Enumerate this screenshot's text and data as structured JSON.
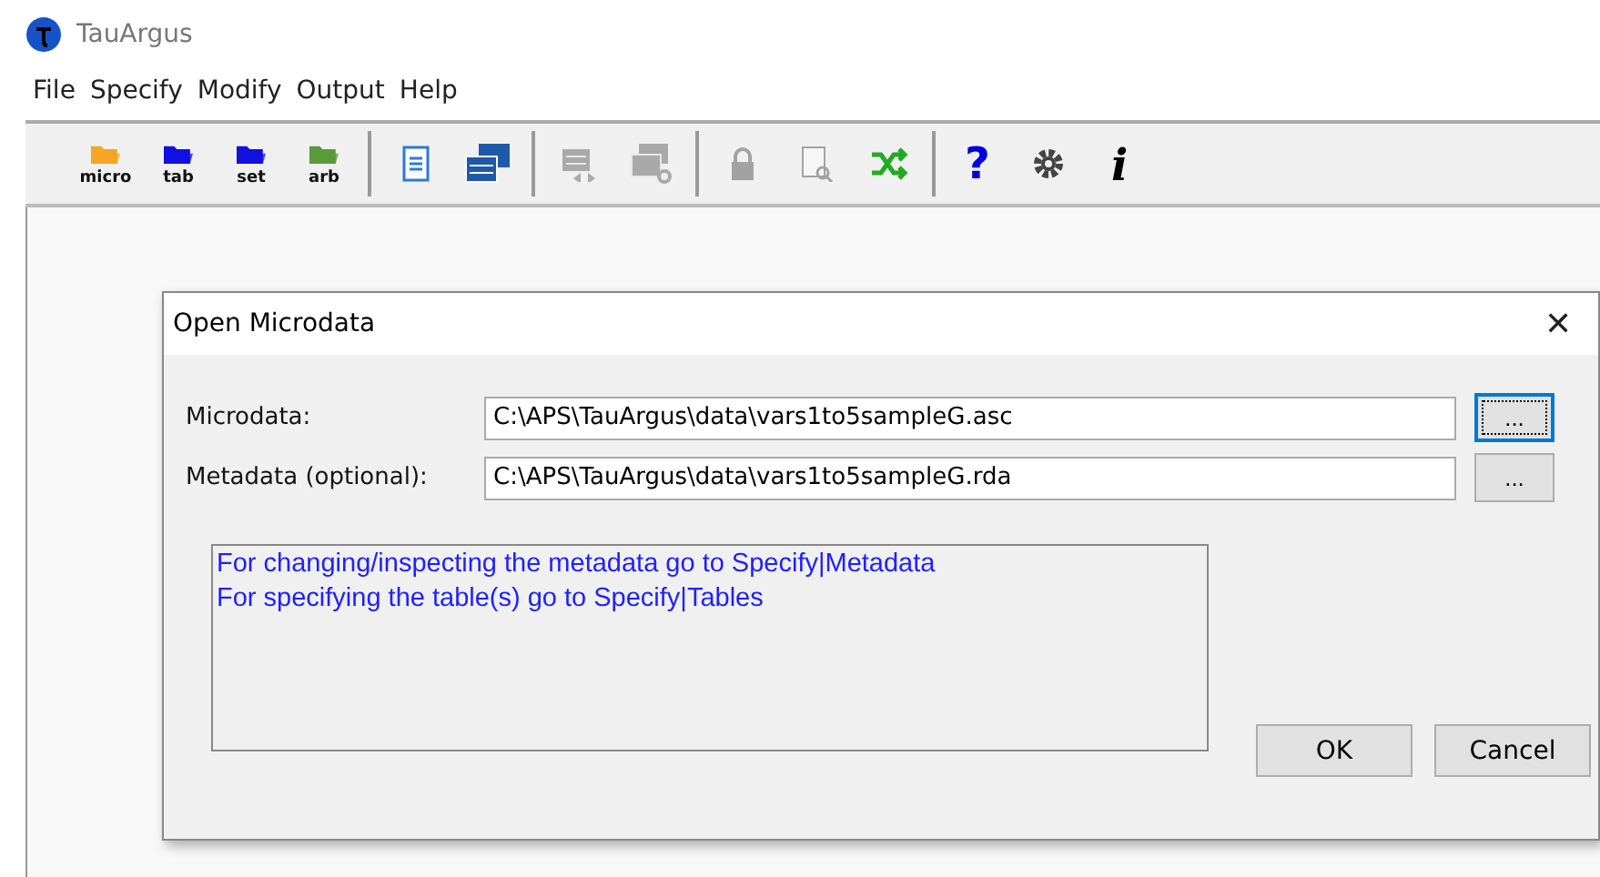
{
  "window": {
    "title": "TauArgus"
  },
  "menu": [
    "File",
    "Specify",
    "Modify",
    "Output",
    "Help"
  ],
  "toolbar": [
    [
      {
        "kind": "folder",
        "label": "micro",
        "color": "#f5a623",
        "disabled": false
      },
      {
        "kind": "folder",
        "label": "tab",
        "color": "#1010e0",
        "disabled": false
      },
      {
        "kind": "folder",
        "label": "set",
        "color": "#1010e0",
        "disabled": false
      },
      {
        "kind": "folder",
        "label": "arb",
        "color": "#5a9a3a",
        "disabled": false
      }
    ],
    [
      {
        "kind": "document",
        "disabled": false
      },
      {
        "kind": "windows",
        "disabled": false
      }
    ],
    [
      {
        "kind": "table-arrow",
        "disabled": true
      },
      {
        "kind": "table-link",
        "disabled": true
      }
    ],
    [
      {
        "kind": "lock",
        "disabled": true
      },
      {
        "kind": "doc-search",
        "disabled": true
      },
      {
        "kind": "shuffle",
        "disabled": false
      }
    ],
    [
      {
        "kind": "text",
        "label": "?",
        "disabled": false
      },
      {
        "kind": "gear",
        "disabled": false
      },
      {
        "kind": "text-italic",
        "label": "i",
        "disabled": false
      }
    ]
  ],
  "dialog": {
    "title": "Open Microdata",
    "close": "✕",
    "fields": [
      {
        "label": "Microdata:",
        "value": "C:\\APS\\TauArgus\\data\\vars1to5sampleG.asc",
        "browse": "...",
        "focused": true
      },
      {
        "label": "Metadata (optional):",
        "value": "C:\\APS\\TauArgus\\data\\vars1to5sampleG.rda",
        "browse": "...",
        "focused": false
      }
    ],
    "message": [
      "For changing/inspecting the metadata go to Specify|Metadata",
      "For specifying the table(s) go to Specify|Tables"
    ],
    "buttons": [
      "OK",
      "Cancel"
    ]
  }
}
